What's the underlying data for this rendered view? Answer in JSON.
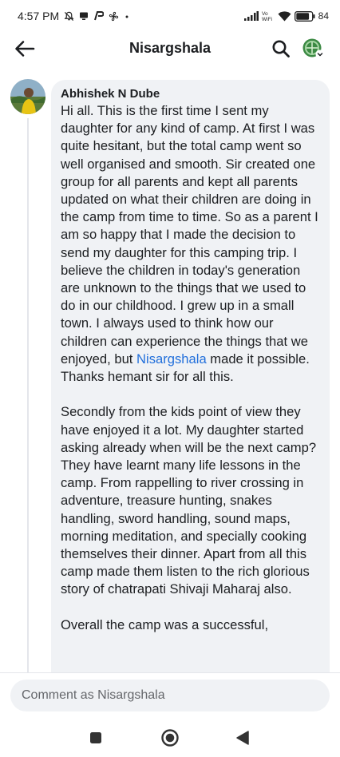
{
  "status_bar": {
    "time": "4:57 PM",
    "battery_percent": "84",
    "battery_level": 0.84,
    "icons": [
      "notification-muted-icon",
      "screen-icon",
      "pay-icon",
      "fan-icon",
      "dot-icon",
      "signal-icon",
      "vowifi-icon",
      "wifi-icon",
      "battery-icon"
    ]
  },
  "header": {
    "title": "Nisargshala",
    "back_icon": "arrow-left-icon",
    "search_icon": "search-icon",
    "profile_icon": "page-avatar-switch-icon"
  },
  "comment": {
    "author": "Abhishek N Dube",
    "para1_before": "Hi all. This is the first time I sent my daughter for any kind of camp. At first I was quite hesitant, but the total camp went so well organised and smooth. Sir created one group for all parents and kept all parents updated on what their children are doing in the camp from time to time. So as a parent I am so happy that I made the decision to send my daughter for this camping trip. I believe the children in today's generation are unknown to the things that we used to do in our childhood. I grew up in a small town. I always used to think how our children can experience the things that we enjoyed, but",
    "mention": "Nisargshala",
    "para1_after": " made it possible. Thanks hemant sir for all this.",
    "para2": "Secondly from the kids point of view they have enjoyed it a lot. My daughter started asking already when will be the next camp? They have learnt many life lessons in the camp. From rappelling to river crossing in adventure, treasure hunting, snakes handling, sword handling, sound maps, morning meditation, and specially cooking themselves their dinner. Apart from all this camp made them listen to the rich glorious story of chatrapati Shivaji Maharaj also.",
    "para3": "Overall the camp was a successful,"
  },
  "composer": {
    "placeholder": "Comment as Nisargshala"
  },
  "nav": {
    "recents_icon": "square-icon",
    "home_icon": "circle-icon",
    "back_icon": "triangle-back-icon"
  }
}
